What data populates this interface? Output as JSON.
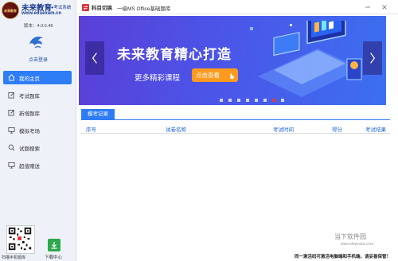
{
  "brand": {
    "logo_text": "未来教育",
    "name": "未来教育",
    "subtitle": "●考试系统",
    "url": "www.eduexam.cn",
    "version": "版本：4.0.0.48"
  },
  "sidebar": {
    "login_label": "点击登录",
    "items": [
      {
        "label": "我的主页",
        "icon": "home-icon",
        "active": true
      },
      {
        "label": "考试题库",
        "icon": "edit-icon",
        "active": false
      },
      {
        "label": "新增题库",
        "icon": "edit-icon",
        "active": false
      },
      {
        "label": "模拟考场",
        "icon": "monitor-icon",
        "active": false
      },
      {
        "label": "试题搜索",
        "icon": "search-icon",
        "active": false
      },
      {
        "label": "超值赠送",
        "icon": "monitor-icon",
        "active": false
      }
    ],
    "qr_label": "扫描手机题库",
    "download_label": "下载中心"
  },
  "titlebar": {
    "switch_label": "科目切换",
    "course_title": "一级MS Office基础题库"
  },
  "banner": {
    "title": "未来教育精心打造",
    "subtitle": "更多精彩课程",
    "button": "点击查看",
    "dot_count": 8,
    "active_dot": 7
  },
  "exam_records": {
    "tab_label": "模考记录",
    "columns": [
      "序号",
      "试卷名称",
      "考试时间",
      "得分",
      "考试结果"
    ]
  },
  "footer": {
    "note": "同一激活码可激活电脑端和手机端，请妥善保管！",
    "watermark": "当下软件园",
    "watermark_url": "www.downxia.com"
  },
  "colors": {
    "accent": "#2f7df6",
    "brand": "#1a3b8f",
    "banner_button": "#ff9a1f"
  }
}
